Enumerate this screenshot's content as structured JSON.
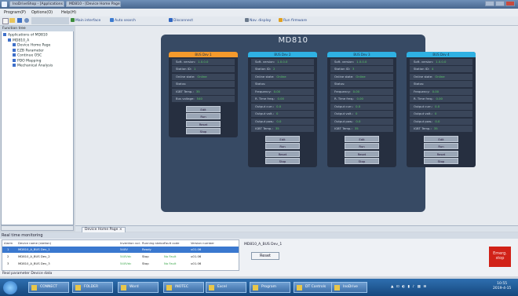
{
  "window": {
    "title_tabs": [
      "InoDriveShop - [Applications 610]",
      "MD810 - [Device Home Page]"
    ],
    "icons": {
      "app": "app-icon",
      "minimize": "minimize-icon",
      "maximize": "maximize-icon",
      "close": "close-icon"
    }
  },
  "menu": [
    "Program(P)",
    "Options(O)",
    "Help(H)"
  ],
  "toolbar": [
    "Main interface",
    "Auto search",
    "Disconnect",
    "Nav. display",
    "Run firmware"
  ],
  "toolbar_colors": [
    "#3c8c3c",
    "#3c7bd0",
    "#2f66c2",
    "#6b7a8c",
    "#e0a020"
  ],
  "tree": {
    "header": "Function tree",
    "items": [
      {
        "label": "Applications of MD810",
        "level": 0
      },
      {
        "label": "MD810_A",
        "level": 1
      },
      {
        "label": "Device Home Page",
        "level": 2
      },
      {
        "label": "EZB Parameter",
        "level": 2
      },
      {
        "label": "Continue OSC",
        "level": 2
      },
      {
        "label": "PDO Mapping",
        "level": 2
      },
      {
        "label": "Mechanical Analysis",
        "level": 2
      }
    ]
  },
  "device": {
    "title": "MD810"
  },
  "modules": [
    {
      "name": "BUS Dev 1",
      "header_color": "#f59a2c",
      "rows": [
        {
          "label": "Soft. version:",
          "value": "1.0.0.0"
        },
        {
          "label": "Station ID:",
          "value": "1"
        },
        {
          "label": "Online state:",
          "value": "Online"
        },
        {
          "label": "Status:",
          "value": ""
        },
        {
          "label": "IGBT Temp.:",
          "value": "35"
        },
        {
          "label": "Bus voltage:",
          "value": "540"
        }
      ],
      "buttons": [
        "Edit",
        "Run",
        "Reset",
        "Stop"
      ]
    },
    {
      "name": "BUS Dev 2",
      "header_color": "#2fb1e3",
      "rows": [
        {
          "label": "Soft. version:",
          "value": "1.0.0.0"
        },
        {
          "label": "Station ID:",
          "value": "2"
        },
        {
          "label": "Online state:",
          "value": "Online"
        },
        {
          "label": "Status:",
          "value": ""
        },
        {
          "label": "Frequency:",
          "value": "0.00"
        },
        {
          "label": "R. Time freq.:",
          "value": "0.00"
        },
        {
          "label": "Output curr.:",
          "value": "0.0"
        },
        {
          "label": "Output volt.:",
          "value": "0"
        },
        {
          "label": "Output pow.:",
          "value": "0.0"
        },
        {
          "label": "IGBT Temp.:",
          "value": "35"
        }
      ],
      "buttons": [
        "Edit",
        "Run",
        "Reset",
        "Stop"
      ]
    },
    {
      "name": "BUS Dev 3",
      "header_color": "#2fb1e3",
      "rows": [
        {
          "label": "Soft. version:",
          "value": "1.0.0.0"
        },
        {
          "label": "Station ID:",
          "value": "3"
        },
        {
          "label": "Online state:",
          "value": "Online"
        },
        {
          "label": "Status:",
          "value": ""
        },
        {
          "label": "Frequency:",
          "value": "0.00"
        },
        {
          "label": "R. Time freq.:",
          "value": "0.00"
        },
        {
          "label": "Output curr.:",
          "value": "0.0"
        },
        {
          "label": "Output volt.:",
          "value": "0"
        },
        {
          "label": "Output pow.:",
          "value": "0.0"
        },
        {
          "label": "IGBT Temp.:",
          "value": "35"
        }
      ],
      "buttons": [
        "Edit",
        "Run",
        "Reset",
        "Stop"
      ]
    },
    {
      "name": "BUS Dev 4",
      "header_color": "#2fb1e3",
      "rows": [
        {
          "label": "Soft. version:",
          "value": "1.0.0.0"
        },
        {
          "label": "Station ID:",
          "value": "4"
        },
        {
          "label": "Online state:",
          "value": "Online"
        },
        {
          "label": "Status:",
          "value": ""
        },
        {
          "label": "Frequency:",
          "value": "0.00"
        },
        {
          "label": "R. Time freq.:",
          "value": "0.00"
        },
        {
          "label": "Output curr.:",
          "value": "0.0"
        },
        {
          "label": "Output volt.:",
          "value": "0"
        },
        {
          "label": "Output pow.:",
          "value": "0.0"
        },
        {
          "label": "IGBT Temp.:",
          "value": "35"
        }
      ],
      "buttons": [
        "Edit",
        "Run",
        "Reset",
        "Stop"
      ]
    }
  ],
  "bottom_tab": {
    "label": "Device Home Page"
  },
  "monitor": {
    "title": "Real time monitoring",
    "columns": [
      "Alarm",
      "Device name (station)",
      "Invention vol.",
      "Running status",
      "Fault code",
      "Version number"
    ],
    "rows": [
      {
        "index": "1",
        "name": "MD810_A_BUS Dev_1",
        "voltage": "540V",
        "status": "Ready",
        "fault": "",
        "version": "u01.06",
        "selected": true
      },
      {
        "index": "2",
        "name": "MD810_A_BUS Dev_2",
        "voltage": "540Vdc",
        "status": "Stop",
        "fault": "No Fault",
        "version": "u01.06",
        "selected": false
      },
      {
        "index": "3",
        "name": "MD810_A_BUS Dev_3",
        "voltage": "540Vdc",
        "status": "Stop",
        "fault": "No Fault",
        "version": "u01.06",
        "selected": false
      }
    ],
    "footer": "Real parameter   Device data",
    "selected_device": "MD810_A_BUS Dev_1",
    "reset_label": "Reset",
    "emergency_label": "Emerg. stop"
  },
  "taskbar": {
    "start": "start-icon",
    "tasks": [
      "CONNECT",
      "FOLDER",
      "Word",
      "INOTEC",
      "Excel",
      "Program",
      "DT Controls",
      "InoDrive"
    ],
    "clock": {
      "time": "10:55",
      "date": "2019-4-15"
    }
  }
}
